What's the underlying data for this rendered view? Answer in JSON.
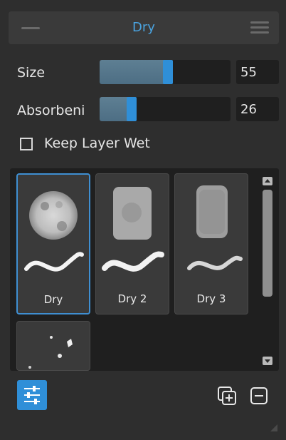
{
  "panel": {
    "title": "Dry"
  },
  "controls": {
    "size": {
      "label": "Size",
      "value": "55",
      "level": 0.54
    },
    "absorbency": {
      "label": "Absorbeni",
      "value": "26",
      "level": 0.26
    },
    "keep_layer_wet": {
      "label": "Keep Layer Wet",
      "checked": false
    }
  },
  "presets": [
    {
      "name": "Dry",
      "selected": true
    },
    {
      "name": "Dry 2",
      "selected": false
    },
    {
      "name": "Dry 3",
      "selected": false
    },
    {
      "name": "",
      "selected": false
    }
  ],
  "colors": {
    "accent": "#3f8fd2",
    "panel_bg": "#2e2e2e",
    "field_bg": "#1f1f1f",
    "tile_bg": "#3a3a3a"
  },
  "icons": {
    "minimize": "minimize-icon",
    "menu": "hamburger-menu-icon",
    "settings": "sliders-icon",
    "duplicate": "duplicate-icon",
    "remove": "remove-icon",
    "resize": "resize-grip-icon"
  }
}
